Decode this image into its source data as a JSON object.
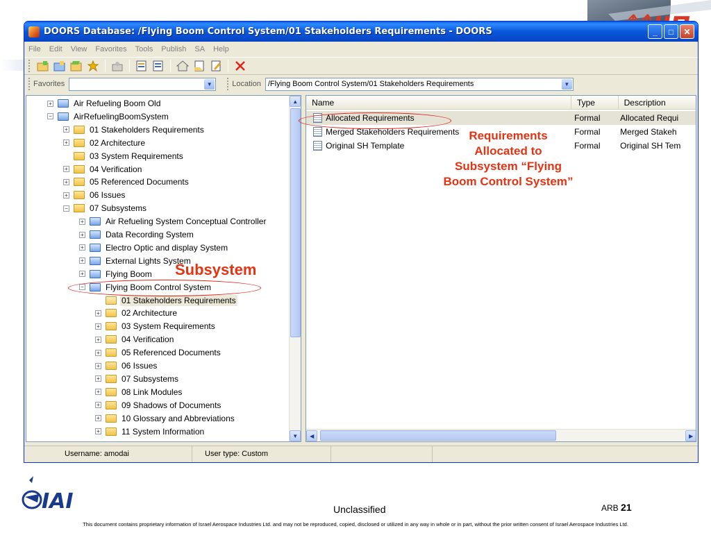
{
  "window": {
    "title": "DOORS Database: /Flying Boom Control System/01 Stakeholders Requirements - DOORS",
    "buttons": [
      "_",
      "□",
      "✕"
    ]
  },
  "menu": [
    "File",
    "Edit",
    "View",
    "Favorites",
    "Tools",
    "Publish",
    "SA",
    "Help"
  ],
  "toolbar": {
    "icons": [
      "new-folder-icon",
      "new-project-icon",
      "open-icon",
      "favorites-star-icon",
      "properties-icon",
      "new-module-icon",
      "edit-module-icon",
      "home-icon",
      "open-document-icon",
      "edit-document-icon",
      "delete-icon"
    ]
  },
  "locationbar": {
    "favorites_label": "Favorites",
    "favorites_value": "",
    "location_label": "Location",
    "location_value": "/Flying Boom Control System/01 Stakeholders Requirements"
  },
  "tree": [
    {
      "label": "Air Refueling Boom Old",
      "expander": "+",
      "icon": "project",
      "indent": 0
    },
    {
      "label": "AirRefuelingBoomSystem",
      "expander": "-",
      "icon": "project",
      "indent": 0
    },
    {
      "label": "01 Stakeholders Requirements",
      "expander": "+",
      "icon": "folder",
      "indent": 1
    },
    {
      "label": "02 Architecture",
      "expander": "+",
      "icon": "folder",
      "indent": 1
    },
    {
      "label": "03 System Requirements",
      "expander": "",
      "icon": "folder",
      "indent": 1
    },
    {
      "label": "04 Verification",
      "expander": "+",
      "icon": "folder",
      "indent": 1
    },
    {
      "label": "05 Referenced Documents",
      "expander": "+",
      "icon": "folder",
      "indent": 1
    },
    {
      "label": "06 Issues",
      "expander": "+",
      "icon": "folder",
      "indent": 1
    },
    {
      "label": "07 Subsystems",
      "expander": "-",
      "icon": "folder",
      "indent": 1
    },
    {
      "label": "Air Refueling System Conceptual Controller",
      "expander": "+",
      "icon": "project",
      "indent": 2
    },
    {
      "label": "Data Recording System",
      "expander": "+",
      "icon": "project",
      "indent": 2
    },
    {
      "label": "Electro Optic and display System",
      "expander": "+",
      "icon": "project",
      "indent": 2
    },
    {
      "label": "External Lights System",
      "expander": "+",
      "icon": "project",
      "indent": 2
    },
    {
      "label": "Flying Boom",
      "expander": "+",
      "icon": "project",
      "indent": 2
    },
    {
      "label": "Flying Boom Control System",
      "expander": "-",
      "icon": "project",
      "indent": 2
    },
    {
      "label": "01 Stakeholders Requirements",
      "expander": "",
      "icon": "open",
      "indent": 3,
      "selected": true
    },
    {
      "label": "02 Architecture",
      "expander": "+",
      "icon": "folder",
      "indent": 3
    },
    {
      "label": "03 System Requirements",
      "expander": "+",
      "icon": "folder",
      "indent": 3
    },
    {
      "label": "04 Verification",
      "expander": "+",
      "icon": "folder",
      "indent": 3
    },
    {
      "label": "05 Referenced Documents",
      "expander": "+",
      "icon": "folder",
      "indent": 3
    },
    {
      "label": "06 Issues",
      "expander": "+",
      "icon": "folder",
      "indent": 3
    },
    {
      "label": "07 Subsystems",
      "expander": "+",
      "icon": "folder",
      "indent": 3
    },
    {
      "label": "08 Link Modules",
      "expander": "+",
      "icon": "folder",
      "indent": 3
    },
    {
      "label": "09 Shadows of Documents",
      "expander": "+",
      "icon": "folder",
      "indent": 3
    },
    {
      "label": "10 Glossary and Abbreviations",
      "expander": "+",
      "icon": "folder",
      "indent": 3
    },
    {
      "label": "11 System Information",
      "expander": "+",
      "icon": "folder",
      "indent": 3
    }
  ],
  "list": {
    "columns": [
      "Name",
      "Type",
      "Description"
    ],
    "rows": [
      {
        "name": "Allocated Requirements",
        "type": "Formal",
        "description": "Allocated Requi",
        "selected": true
      },
      {
        "name": "Merged Stakeholders Requirements",
        "type": "Formal",
        "description": "Merged Stakeh"
      },
      {
        "name": "Original SH Template",
        "type": "Formal",
        "description": "Original SH Tem"
      }
    ]
  },
  "status": {
    "username": "Username: amodai",
    "usertype": "User type: Custom"
  },
  "annotations": {
    "subsystem": "Subsystem",
    "requirements": [
      "Requirements",
      "Allocated to",
      "Subsystem “Flying",
      "Boom Control System”"
    ],
    "color": "#e63312"
  },
  "footer": {
    "logo_text": "IAI",
    "classification": "Unclassified",
    "page_prefix": "ARB",
    "page_number": "21",
    "notice": "This document contains proprietary information of Israel Aerospace Industries Ltd. and may not be reproduced, copied, disclosed or utilized in any way in whole or in part, without the prior written consent of Israel Aerospace Industries Ltd."
  }
}
